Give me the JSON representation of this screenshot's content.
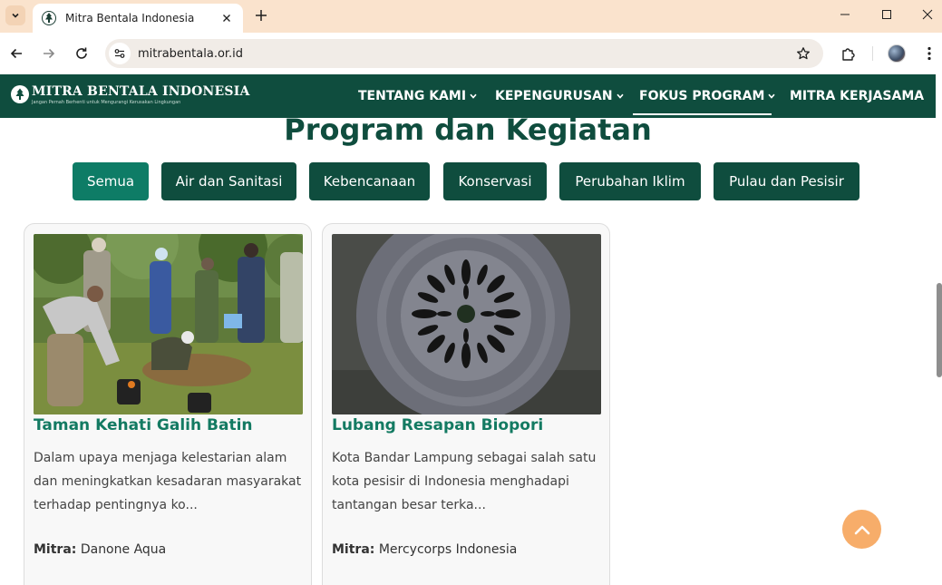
{
  "browser": {
    "tab_title": "Mitra Bentala Indonesia",
    "url": "mitrabentala.or.id"
  },
  "site": {
    "logo_name": "MITRA BENTALA INDONESIA",
    "logo_tagline": "Jangan Pernah Berhenti untuk Mengurangi Kerusakan Lingkungan",
    "menu": [
      {
        "label": "TENTANG KAMI",
        "has_dropdown": true
      },
      {
        "label": "KEPENGURUSAN",
        "has_dropdown": true
      },
      {
        "label": "FOKUS PROGRAM",
        "has_dropdown": true,
        "active": true
      },
      {
        "label": "MITRA KERJASAMA",
        "has_dropdown": false
      }
    ],
    "brand_color": "#0f4d3e",
    "accent_color": "#0e7c66"
  },
  "page": {
    "heading": "Program dan Kegiatan",
    "filters": [
      {
        "label": "Semua",
        "active": true
      },
      {
        "label": "Air dan Sanitasi",
        "active": false
      },
      {
        "label": "Kebencanaan",
        "active": false
      },
      {
        "label": "Konservasi",
        "active": false
      },
      {
        "label": "Perubahan Iklim",
        "active": false
      },
      {
        "label": "Pulau dan Pesisir",
        "active": false
      }
    ],
    "partner_label": "Mitra:",
    "cards": [
      {
        "title": "Taman Kehati Galih Batin",
        "description": "Dalam upaya menjaga kelestarian alam dan meningkatkan kesadaran masyarakat terhadap pentingnya ko...",
        "partner": "Danone Aqua",
        "image": "tree-planting-photo"
      },
      {
        "title": "Lubang Resapan Biopori",
        "description": "Kota Bandar Lampung sebagai salah satu kota pesisir di Indonesia menghadapi tantangan besar terka...",
        "partner": "Mercycorps Indonesia",
        "image": "biopori-cover-photo"
      }
    ]
  }
}
